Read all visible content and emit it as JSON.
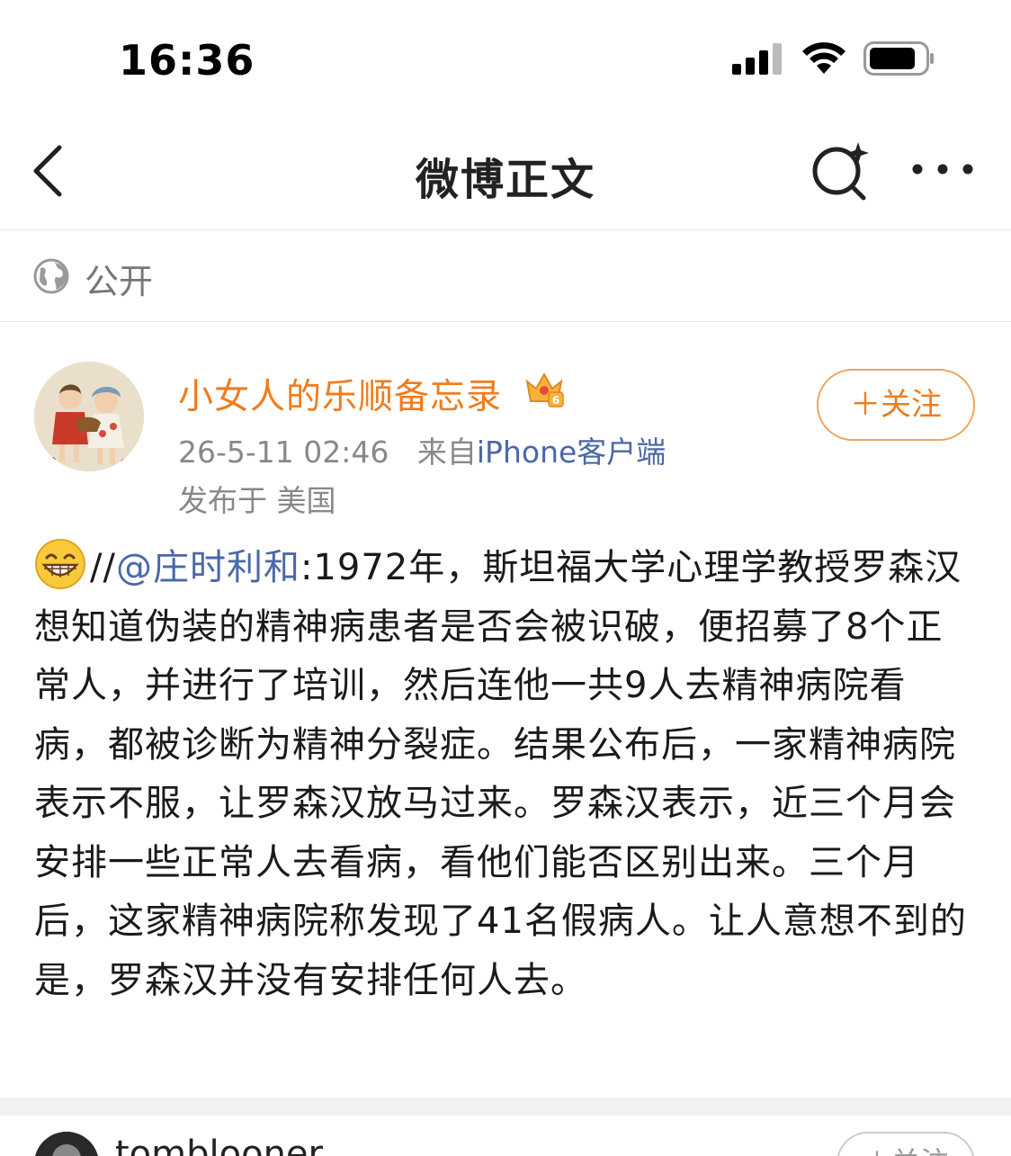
{
  "status_bar": {
    "time": "16:36"
  },
  "nav": {
    "title": "微博正文"
  },
  "visibility": {
    "label": "公开"
  },
  "post": {
    "author": "小女人的乐顺备忘录",
    "timestamp": "26-5-11 02:46",
    "source_prefix": "来自",
    "source": "iPhone客户端",
    "location": "发布于 美国",
    "follow_label": "＋关注",
    "body_prefix": "//",
    "mention": "@庄时利和",
    "body_text": ":1972年，斯坦福大学心理学教授罗森汉想知道伪装的精神病患者是否会被识破，便招募了8个正常人，并进行了培训，然后连他一共9人去精神病院看病，都被诊断为精神分裂症。结果公布后，一家精神病院表示不服，让罗森汉放马过来。罗森汉表示，近三个月会安排一些正常人去看病，看他们能否区别出来。三个月后，这家精神病院称发现了41名假病人。让人意想不到的是，罗森汉并没有安排任何人去。"
  },
  "next_post": {
    "author": "tomblooner",
    "follow_label": "＋关注"
  },
  "colors": {
    "accent": "#f07c1c",
    "link": "#4a68a8",
    "muted": "#888888"
  },
  "icons": [
    "back-chevron-icon",
    "search-sparkle-icon",
    "more-icon",
    "globe-icon",
    "crown-icon",
    "grin-emoji-icon",
    "signal-icon",
    "wifi-icon",
    "battery-icon"
  ]
}
